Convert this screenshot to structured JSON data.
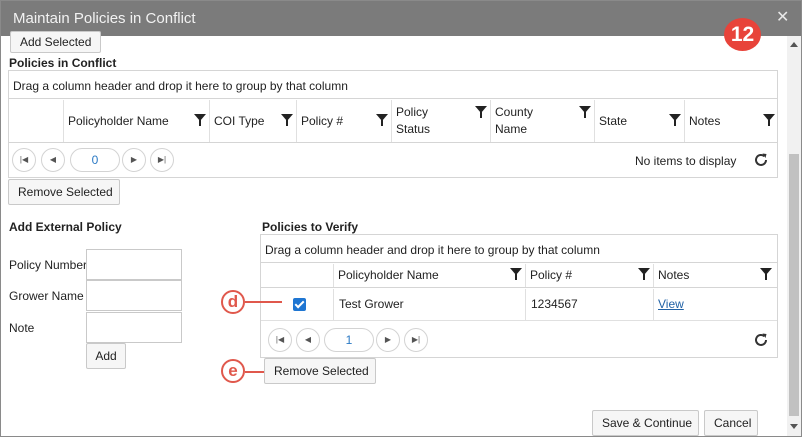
{
  "dialog": {
    "title": "Maintain Policies in Conflict",
    "close_glyph": "✕"
  },
  "badges": {
    "step": "12",
    "callout_d": "d",
    "callout_e": "e"
  },
  "top": {
    "add_selected_label": "Add Selected"
  },
  "conflict": {
    "title": "Policies in Conflict",
    "group_hint": "Drag a column header and drop it here to group by that column",
    "columns": [
      "Policyholder Name",
      "COI Type",
      "Policy #",
      "Policy Status",
      "County Name",
      "State",
      "Notes"
    ],
    "pager": {
      "page": "0",
      "status": "No items to display"
    },
    "remove_label": "Remove Selected"
  },
  "external": {
    "title": "Add External Policy",
    "labels": [
      "Policy Number",
      "Grower Name",
      "Note"
    ],
    "values": [
      "",
      "",
      ""
    ],
    "add_label": "Add"
  },
  "verify": {
    "title": "Policies to Verify",
    "group_hint": "Drag a column header and drop it here to group by that column",
    "columns": [
      "Policyholder Name",
      "Policy #",
      "Notes"
    ],
    "rows": [
      {
        "checked": true,
        "name": "Test Grower",
        "policy": "1234567",
        "notes": "View"
      }
    ],
    "pager": {
      "page": "1"
    },
    "remove_label": "Remove Selected"
  },
  "footer": {
    "save_label": "Save & Continue",
    "cancel_label": "Cancel"
  },
  "colors": {
    "titlebar": "#7b7b7b",
    "badge": "#e8433a",
    "callout": "#e0584c",
    "checkbox": "#1f76d2",
    "link": "#2162a6"
  },
  "icons": [
    "close-icon",
    "filter-icon",
    "first-page-icon",
    "prev-page-icon",
    "next-page-icon",
    "last-page-icon",
    "refresh-icon"
  ]
}
